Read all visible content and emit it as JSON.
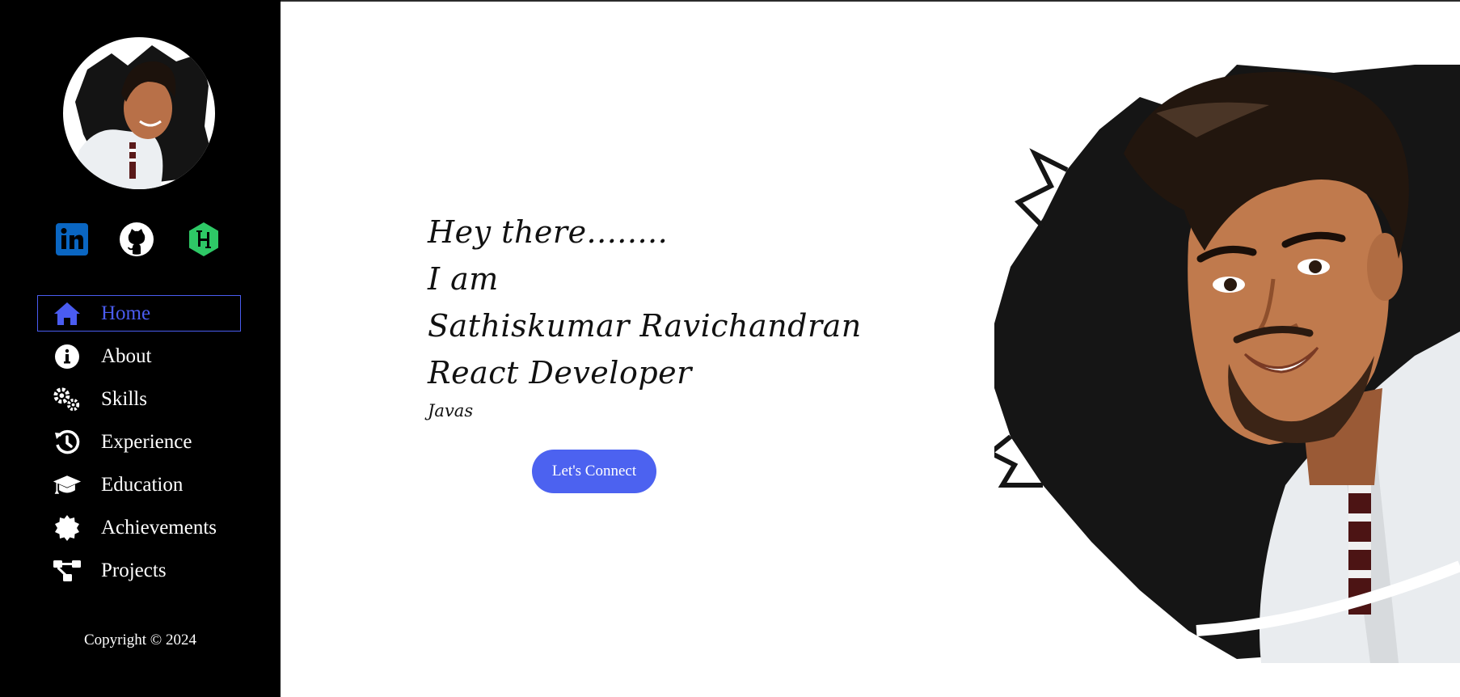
{
  "sidebar": {
    "avatar_icon": "profile-photo",
    "socials": [
      {
        "name": "LinkedIn",
        "icon": "linkedin-icon",
        "color": "#0a66c2"
      },
      {
        "name": "GitHub",
        "icon": "github-icon",
        "color": "#ffffff"
      },
      {
        "name": "HackerRank",
        "icon": "hackerrank-icon",
        "color": "#2ec866"
      }
    ],
    "nav": [
      {
        "label": "Home",
        "icon": "home-icon",
        "active": true
      },
      {
        "label": "About",
        "icon": "info-icon",
        "active": false
      },
      {
        "label": "Skills",
        "icon": "gears-icon",
        "active": false
      },
      {
        "label": "Experience",
        "icon": "history-icon",
        "active": false
      },
      {
        "label": "Education",
        "icon": "graduation-cap-icon",
        "active": false
      },
      {
        "label": "Achievements",
        "icon": "badge-icon",
        "active": false
      },
      {
        "label": "Projects",
        "icon": "project-diagram-icon",
        "active": false
      }
    ],
    "copyright": "Copyright © 2024"
  },
  "hero": {
    "greeting": "Hey there........",
    "intro": "I am",
    "name": "Sathiskumar Ravichandran",
    "role": "React Developer",
    "typing": "Javas",
    "cta_label": "Let's Connect"
  },
  "colors": {
    "accent": "#4c62f0",
    "sidebar_bg": "#000000",
    "active_nav": "#4a5cf0"
  }
}
